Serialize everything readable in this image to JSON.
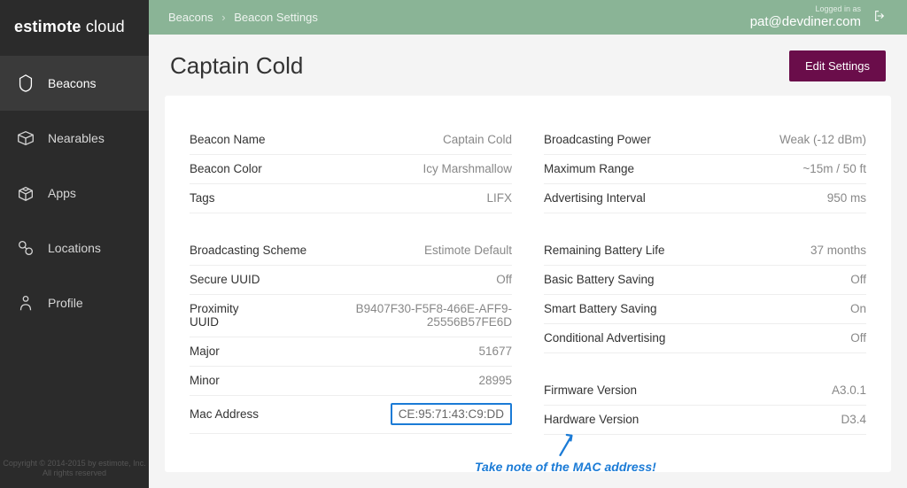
{
  "brand": {
    "name": "estimote",
    "suffix": "cloud"
  },
  "sidebar": {
    "items": [
      {
        "label": "Beacons"
      },
      {
        "label": "Nearables"
      },
      {
        "label": "Apps"
      },
      {
        "label": "Locations"
      },
      {
        "label": "Profile"
      }
    ],
    "copyright_line1": "Copyright © 2014-2015 by estimote, Inc.",
    "copyright_line2": "All rights reserved"
  },
  "topbar": {
    "breadcrumb_root": "Beacons",
    "breadcrumb_sep": "›",
    "breadcrumb_current": "Beacon Settings",
    "logged_in_as": "Logged in as",
    "user_email": "pat@devdiner.com"
  },
  "page": {
    "title": "Captain Cold",
    "edit_button": "Edit Settings"
  },
  "details": {
    "left1": [
      {
        "label": "Beacon Name",
        "value": "Captain Cold"
      },
      {
        "label": "Beacon Color",
        "value": "Icy Marshmallow"
      },
      {
        "label": "Tags",
        "value": "LIFX"
      }
    ],
    "left2": [
      {
        "label": "Broadcasting Scheme",
        "value": "Estimote Default"
      },
      {
        "label": "Secure UUID",
        "value": "Off"
      },
      {
        "label": "Proximity UUID",
        "value": "B9407F30-F5F8-466E-AFF9-25556B57FE6D"
      },
      {
        "label": "Major",
        "value": "51677"
      },
      {
        "label": "Minor",
        "value": "28995"
      },
      {
        "label": "Mac Address",
        "value": "CE:95:71:43:C9:DD"
      }
    ],
    "right1": [
      {
        "label": "Broadcasting Power",
        "value": "Weak (-12 dBm)"
      },
      {
        "label": "Maximum Range",
        "value": "~15m / 50 ft"
      },
      {
        "label": "Advertising Interval",
        "value": "950 ms"
      }
    ],
    "right2": [
      {
        "label": "Remaining Battery Life",
        "value": "37 months"
      },
      {
        "label": "Basic Battery Saving",
        "value": "Off"
      },
      {
        "label": "Smart Battery Saving",
        "value": "On"
      },
      {
        "label": "Conditional Advertising",
        "value": "Off"
      }
    ],
    "right3": [
      {
        "label": "Firmware Version",
        "value": "A3.0.1"
      },
      {
        "label": "Hardware Version",
        "value": "D3.4"
      }
    ]
  },
  "annotation": "Take note of the MAC address!"
}
